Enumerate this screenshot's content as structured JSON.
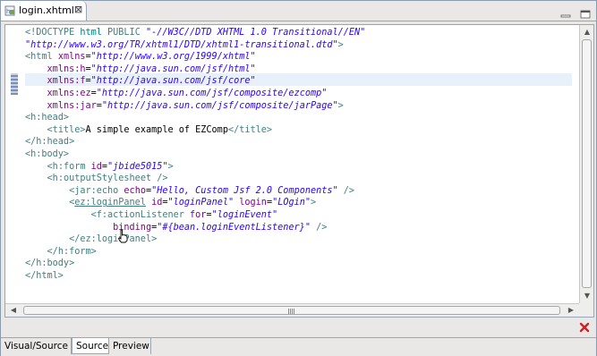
{
  "editor_tab": {
    "filename": "login.xhtml",
    "close_glyph": "⊠",
    "file_icon": "xhtml-file-icon"
  },
  "window_controls": {
    "minimize_icon": "minimize-icon",
    "maximize_icon": "maximize-icon"
  },
  "code_lines": [
    {
      "parts": [
        {
          "c": "t-doc",
          "t": "<!DOCTYPE "
        },
        {
          "c": "t-dochi",
          "t": "html"
        },
        {
          "c": "t-doc",
          "t": " PUBLIC "
        },
        {
          "c": "t-val",
          "t": "\"-//W3C//DTD XHTML 1.0 Transitional//EN\""
        }
      ]
    },
    {
      "parts": [
        {
          "c": "t-val",
          "t": "\"http://www.w3.org/TR/xhtml1/DTD/xhtml1-transitional.dtd\""
        },
        {
          "c": "t-doc",
          "t": ">"
        }
      ]
    },
    {
      "parts": [
        {
          "c": "t-tag",
          "t": "<html "
        },
        {
          "c": "t-attr",
          "t": "xmlns"
        },
        {
          "c": "",
          "t": "="
        },
        {
          "c": "t-val",
          "t": "\"http://www.w3.org/1999/xhtml\""
        }
      ]
    },
    {
      "parts": [
        {
          "c": "",
          "t": "    "
        },
        {
          "c": "t-attr",
          "t": "xmlns:h"
        },
        {
          "c": "",
          "t": "="
        },
        {
          "c": "t-val",
          "t": "\"http://java.sun.com/jsf/html\""
        }
      ]
    },
    {
      "parts": [
        {
          "c": "",
          "t": "    "
        },
        {
          "c": "t-attr",
          "t": "xmlns:f"
        },
        {
          "c": "",
          "t": "="
        },
        {
          "c": "t-val",
          "t": "\"http://java.sun.com/jsf/core\""
        }
      ]
    },
    {
      "parts": [
        {
          "c": "",
          "t": "    "
        },
        {
          "c": "t-attr",
          "t": "xmlns:ez"
        },
        {
          "c": "",
          "t": "="
        },
        {
          "c": "t-val",
          "t": "\"http://java.sun.com/jsf/composite/ezcomp\""
        }
      ]
    },
    {
      "parts": [
        {
          "c": "",
          "t": "    "
        },
        {
          "c": "t-attr",
          "t": "xmlns:jar"
        },
        {
          "c": "",
          "t": "="
        },
        {
          "c": "t-val",
          "t": "\"http://java.sun.com/jsf/composite/jarPage\""
        },
        {
          "c": "t-tag",
          "t": ">"
        }
      ]
    },
    {
      "parts": [
        {
          "c": "t-tag",
          "t": "<h:head>"
        }
      ]
    },
    {
      "parts": [
        {
          "c": "",
          "t": "    "
        },
        {
          "c": "t-tag",
          "t": "<title>"
        },
        {
          "c": "",
          "t": "A simple example of EZComp"
        },
        {
          "c": "t-tag",
          "t": "</title>"
        }
      ]
    },
    {
      "parts": [
        {
          "c": "t-tag",
          "t": "</h:head>"
        }
      ]
    },
    {
      "parts": [
        {
          "c": "t-tag",
          "t": "<h:body>"
        }
      ]
    },
    {
      "parts": [
        {
          "c": "",
          "t": "    "
        },
        {
          "c": "t-tag",
          "t": "<h:form "
        },
        {
          "c": "t-attr",
          "t": "id"
        },
        {
          "c": "",
          "t": "="
        },
        {
          "c": "t-val",
          "t": "\"jbide5015\""
        },
        {
          "c": "t-tag",
          "t": ">"
        }
      ]
    },
    {
      "parts": [
        {
          "c": "",
          "t": "    "
        },
        {
          "c": "t-tag",
          "t": "<h:outputStylesheet />"
        }
      ]
    },
    {
      "parts": [
        {
          "c": "",
          "t": "        "
        },
        {
          "c": "t-tag",
          "t": "<jar:echo "
        },
        {
          "c": "t-attr",
          "t": "echo"
        },
        {
          "c": "",
          "t": "="
        },
        {
          "c": "t-val",
          "t": "\"Hello, Custom Jsf 2.0 Components\""
        },
        {
          "c": "t-tag",
          "t": " />"
        }
      ]
    },
    {
      "parts": [
        {
          "c": "",
          "t": "        "
        },
        {
          "c": "t-tag",
          "t": "<"
        },
        {
          "c": "t-tag u",
          "t": "ez:loginPanel"
        },
        {
          "c": "t-tag",
          "t": " "
        },
        {
          "c": "t-attr",
          "t": "id"
        },
        {
          "c": "",
          "t": "="
        },
        {
          "c": "t-val",
          "t": "\"loginPanel\""
        },
        {
          "c": "t-tag",
          "t": " "
        },
        {
          "c": "t-attr",
          "t": "login"
        },
        {
          "c": "",
          "t": "="
        },
        {
          "c": "t-val",
          "t": "\"LOgin\""
        },
        {
          "c": "t-tag",
          "t": ">"
        }
      ]
    },
    {
      "parts": [
        {
          "c": "",
          "t": "            "
        },
        {
          "c": "t-tag",
          "t": "<f:actionListener "
        },
        {
          "c": "t-attr",
          "t": "for"
        },
        {
          "c": "",
          "t": "="
        },
        {
          "c": "t-val",
          "t": "\"loginEvent\""
        }
      ]
    },
    {
      "parts": [
        {
          "c": "",
          "t": "                "
        },
        {
          "c": "t-attr",
          "t": "binding"
        },
        {
          "c": "",
          "t": "="
        },
        {
          "c": "t-val",
          "t": "\"#{bean.loginEventListener}\""
        },
        {
          "c": "t-tag",
          "t": " />"
        }
      ]
    },
    {
      "parts": [
        {
          "c": "",
          "t": "        "
        },
        {
          "c": "t-tag",
          "t": "</ez:loginPanel>"
        }
      ]
    },
    {
      "parts": [
        {
          "c": "",
          "t": "    "
        },
        {
          "c": "t-tag",
          "t": "</h:form>"
        }
      ]
    },
    {
      "parts": [
        {
          "c": "t-tag",
          "t": "</h:body>"
        }
      ]
    },
    {
      "parts": [
        {
          "c": "t-tag",
          "t": "</html>"
        }
      ]
    }
  ],
  "bottom_tabs": [
    {
      "label": "Visual/Source",
      "active": false
    },
    {
      "label": "Source",
      "active": true
    },
    {
      "label": "Preview",
      "active": false
    }
  ],
  "colors": {
    "tag": "#3f7f7f",
    "attribute": "#7f007f",
    "value": "#2a00ff",
    "current_line": "#e8f0fb",
    "error": "#d02020"
  },
  "icons": {
    "error_button": "close-red-icon",
    "mouse_cursor": "hand-pointer-icon",
    "ruler_marker": "quick-diff-marker-icon"
  }
}
